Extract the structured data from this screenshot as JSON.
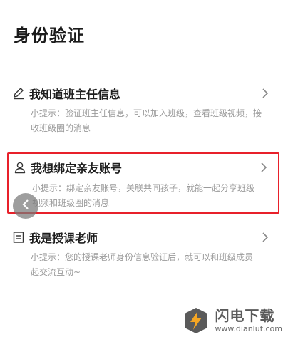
{
  "page": {
    "title": "身份验证"
  },
  "options": [
    {
      "icon": "pencil-icon",
      "label": "我知道班主任信息",
      "hint": "小提示：验证班主任信息，可以加入班级，查看班级视频，接收班级圈的消息"
    },
    {
      "icon": "person-icon",
      "label": "我想绑定亲友账号",
      "hint": "小提示：绑定亲友账号，关联共同孩子，就能一起分享班级视频和班级圈的消息",
      "highlighted": true,
      "highlight_color": "#e8202a"
    },
    {
      "icon": "id-card-icon",
      "label": "我是授课老师",
      "hint": "小提示：您的授课老师身份信息验证后，就可以和班级成员一起交流互动~"
    }
  ],
  "overlay": {
    "back_button_icon": "chevron-left-icon"
  },
  "watermark": {
    "name": "闪电下载",
    "url": "www.dianlut.com",
    "logo_color": "#f5a623"
  }
}
